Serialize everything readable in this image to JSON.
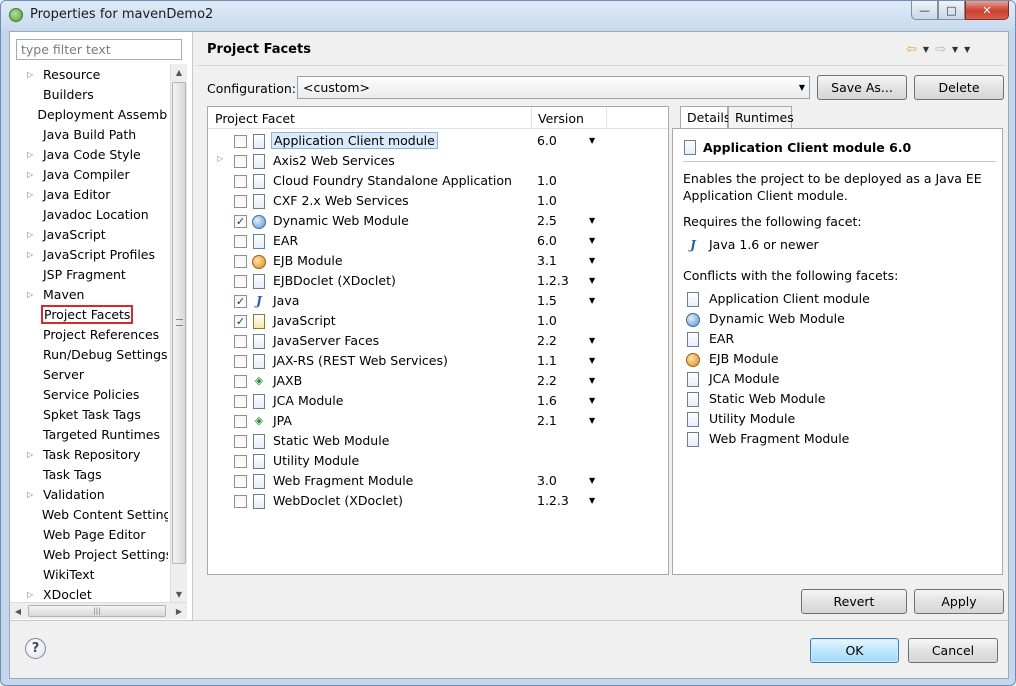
{
  "window": {
    "title": "Properties for mavenDemo2",
    "min_glyph": "—",
    "max_glyph": "□",
    "close_glyph": "✕"
  },
  "filter": {
    "placeholder": "type filter text"
  },
  "tree": {
    "items": [
      {
        "label": "Resource",
        "expandable": true
      },
      {
        "label": "Builders",
        "expandable": false
      },
      {
        "label": "Deployment Assembly",
        "expandable": false
      },
      {
        "label": "Java Build Path",
        "expandable": false
      },
      {
        "label": "Java Code Style",
        "expandable": true
      },
      {
        "label": "Java Compiler",
        "expandable": true
      },
      {
        "label": "Java Editor",
        "expandable": true
      },
      {
        "label": "Javadoc Location",
        "expandable": false
      },
      {
        "label": "JavaScript",
        "expandable": true
      },
      {
        "label": "JavaScript Profiles",
        "expandable": true
      },
      {
        "label": "JSP Fragment",
        "expandable": false
      },
      {
        "label": "Maven",
        "expandable": true
      },
      {
        "label": "Project Facets",
        "expandable": false,
        "selected": true
      },
      {
        "label": "Project References",
        "expandable": false
      },
      {
        "label": "Run/Debug Settings",
        "expandable": false
      },
      {
        "label": "Server",
        "expandable": false
      },
      {
        "label": "Service Policies",
        "expandable": false
      },
      {
        "label": "Spket Task Tags",
        "expandable": false
      },
      {
        "label": "Targeted Runtimes",
        "expandable": false
      },
      {
        "label": "Task Repository",
        "expandable": true
      },
      {
        "label": "Task Tags",
        "expandable": false
      },
      {
        "label": "Validation",
        "expandable": true
      },
      {
        "label": "Web Content Settings",
        "expandable": false
      },
      {
        "label": "Web Page Editor",
        "expandable": false
      },
      {
        "label": "Web Project Settings",
        "expandable": false
      },
      {
        "label": "WikiText",
        "expandable": false
      },
      {
        "label": "XDoclet",
        "expandable": true
      }
    ]
  },
  "page": {
    "title": "Project Facets",
    "configuration_label": "Configuration:",
    "configuration_value": "<custom>",
    "save_as_label": "Save As...",
    "delete_label": "Delete"
  },
  "facets": {
    "col_facet": "Project Facet",
    "col_version": "Version",
    "rows": [
      {
        "name": "Application Client module",
        "version": "6.0",
        "checked": false,
        "icon": "page",
        "dropdown": true,
        "selected": true,
        "expandable": false
      },
      {
        "name": "Axis2 Web Services",
        "version": "",
        "checked": false,
        "icon": "page",
        "dropdown": false,
        "expandable": true
      },
      {
        "name": "Cloud Foundry Standalone Application",
        "version": "1.0",
        "checked": false,
        "icon": "page",
        "dropdown": false,
        "expandable": false
      },
      {
        "name": "CXF 2.x Web Services",
        "version": "1.0",
        "checked": false,
        "icon": "page",
        "dropdown": false,
        "expandable": false
      },
      {
        "name": "Dynamic Web Module",
        "version": "2.5",
        "checked": true,
        "icon": "globe",
        "dropdown": true,
        "expandable": false
      },
      {
        "name": "EAR",
        "version": "6.0",
        "checked": false,
        "icon": "page",
        "dropdown": true,
        "expandable": false
      },
      {
        "name": "EJB Module",
        "version": "3.1",
        "checked": false,
        "icon": "bean",
        "dropdown": true,
        "expandable": false
      },
      {
        "name": "EJBDoclet (XDoclet)",
        "version": "1.2.3",
        "checked": false,
        "icon": "page",
        "dropdown": true,
        "expandable": false
      },
      {
        "name": "Java",
        "version": "1.5",
        "checked": true,
        "icon": "jar",
        "dropdown": true,
        "expandable": false
      },
      {
        "name": "JavaScript",
        "version": "1.0",
        "checked": true,
        "icon": "js",
        "dropdown": false,
        "expandable": false
      },
      {
        "name": "JavaServer Faces",
        "version": "2.2",
        "checked": false,
        "icon": "page",
        "dropdown": true,
        "expandable": false
      },
      {
        "name": "JAX-RS (REST Web Services)",
        "version": "1.1",
        "checked": false,
        "icon": "page",
        "dropdown": true,
        "expandable": false
      },
      {
        "name": "JAXB",
        "version": "2.2",
        "checked": false,
        "icon": "diamond",
        "dropdown": true,
        "expandable": false
      },
      {
        "name": "JCA Module",
        "version": "1.6",
        "checked": false,
        "icon": "page",
        "dropdown": true,
        "expandable": false
      },
      {
        "name": "JPA",
        "version": "2.1",
        "checked": false,
        "icon": "diamond",
        "dropdown": true,
        "expandable": false
      },
      {
        "name": "Static Web Module",
        "version": "",
        "checked": false,
        "icon": "page",
        "dropdown": false,
        "expandable": false
      },
      {
        "name": "Utility Module",
        "version": "",
        "checked": false,
        "icon": "page",
        "dropdown": false,
        "expandable": false
      },
      {
        "name": "Web Fragment Module",
        "version": "3.0",
        "checked": false,
        "icon": "page",
        "dropdown": true,
        "expandable": false
      },
      {
        "name": "WebDoclet (XDoclet)",
        "version": "1.2.3",
        "checked": false,
        "icon": "page",
        "dropdown": true,
        "expandable": false
      }
    ]
  },
  "details": {
    "tab_details": "Details",
    "tab_runtimes": "Runtimes",
    "title": "Application Client module 6.0",
    "description": "Enables the project to be deployed as a Java EE Application Client module.",
    "requires_label": "Requires the following facet:",
    "requires": [
      {
        "name": "Java 1.6 or newer",
        "icon": "jar"
      }
    ],
    "conflicts_label": "Conflicts with the following facets:",
    "conflicts": [
      {
        "name": "Application Client module",
        "icon": "page"
      },
      {
        "name": "Dynamic Web Module",
        "icon": "globe"
      },
      {
        "name": "EAR",
        "icon": "page"
      },
      {
        "name": "EJB Module",
        "icon": "bean"
      },
      {
        "name": "JCA Module",
        "icon": "page"
      },
      {
        "name": "Static Web Module",
        "icon": "page"
      },
      {
        "name": "Utility Module",
        "icon": "page"
      },
      {
        "name": "Web Fragment Module",
        "icon": "page"
      }
    ]
  },
  "buttons": {
    "revert": "Revert",
    "apply": "Apply",
    "ok": "OK",
    "cancel": "Cancel",
    "help": "?"
  },
  "icons": {
    "nav_back": "⇦",
    "nav_forward": "⇨",
    "dropdown": "▼",
    "expand": "▷",
    "check": "✓",
    "jar_glyph": "J",
    "diamond_glyph": "◈"
  },
  "colors": {
    "selection_highlight": "#d9272e",
    "row_selected": "#dbe9fa",
    "ok_button": "#bee6fd"
  }
}
